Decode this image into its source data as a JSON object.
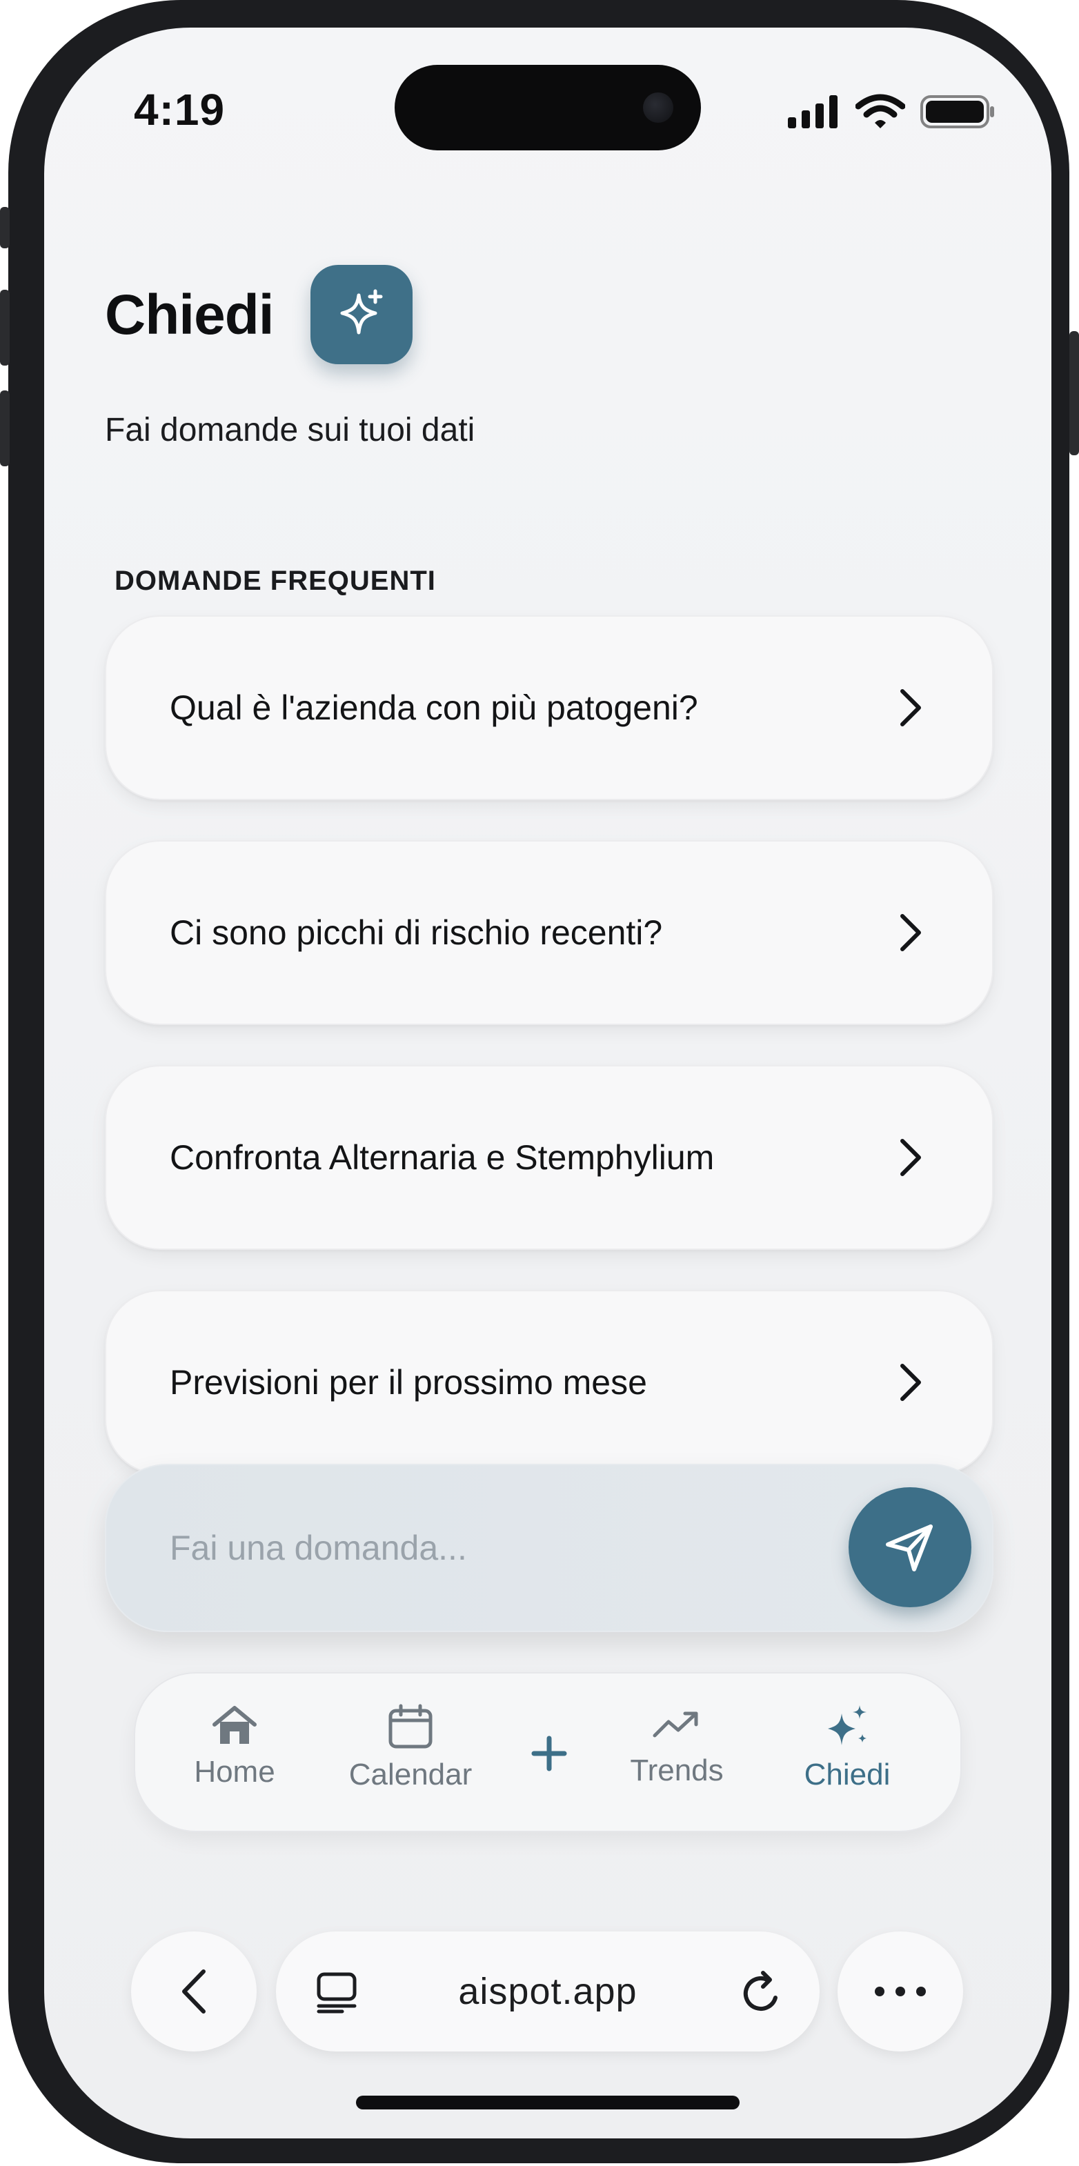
{
  "status_bar": {
    "time": "4:19"
  },
  "header": {
    "title": "Chiedi",
    "subtitle": "Fai domande sui tuoi dati",
    "badge_icon": "sparkle-icon",
    "accent_color": "#3f7088"
  },
  "faq": {
    "section_label": "DOMANDE FREQUENTI",
    "items": [
      {
        "label": "Qual è l'azienda con più patogeni?"
      },
      {
        "label": "Ci sono picchi di rischio recenti?"
      },
      {
        "label": "Confronta Alternaria e Stemphylium"
      },
      {
        "label": "Previsioni per il prossimo mese"
      }
    ]
  },
  "ask": {
    "placeholder": "Fai una domanda..."
  },
  "tabbar": {
    "tabs": [
      {
        "label": "Home",
        "icon": "home-icon"
      },
      {
        "label": "Calendar",
        "icon": "calendar-icon"
      },
      {
        "label": "",
        "icon": "plus-icon"
      },
      {
        "label": "Trends",
        "icon": "trending-icon"
      },
      {
        "label": "Chiedi",
        "icon": "sparkle-icon",
        "active": true
      }
    ]
  },
  "browser": {
    "url": "aispot.app"
  }
}
